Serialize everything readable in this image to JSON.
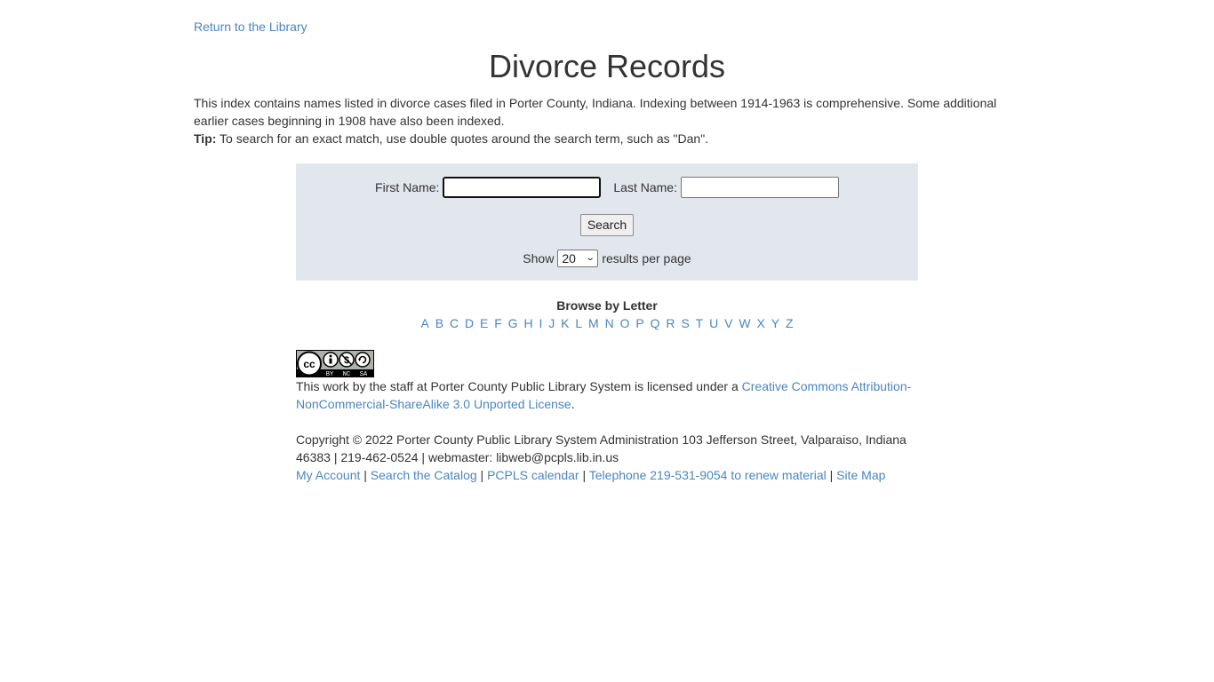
{
  "header": {
    "return_link": "Return to the Library",
    "title": "Divorce Records"
  },
  "intro": {
    "description": "This index contains names listed in divorce cases filed in Porter County, Indiana. Indexing between 1914-1963 is comprehensive. Some additional earlier cases beginning in 1908 have also been indexed.",
    "tip_label": "Tip:",
    "tip_text": " To search for an exact match, use double quotes around the search term, such as \"Dan\"."
  },
  "search": {
    "first_name_label": "First Name:",
    "first_name_value": "",
    "last_name_label": "Last Name:",
    "last_name_value": "",
    "search_button": "Search",
    "show_label": "Show",
    "per_page_value": "20",
    "per_page_suffix": "results per page"
  },
  "browse": {
    "title": "Browse by Letter",
    "letters": [
      "A",
      "B",
      "C",
      "D",
      "E",
      "F",
      "G",
      "H",
      "I",
      "J",
      "K",
      "L",
      "M",
      "N",
      "O",
      "P",
      "Q",
      "R",
      "S",
      "T",
      "U",
      "V",
      "W",
      "X",
      "Y",
      "Z"
    ]
  },
  "footer": {
    "cc_badge": {
      "main": "cc",
      "by": "BY",
      "nc": "NC",
      "sa": "SA"
    },
    "license_text": "This work by the staff at Porter County Public Library System is licensed under a ",
    "license_link": "Creative Commons Attribution-NonCommercial-ShareAlike 3.0 Unported License",
    "license_end": ".",
    "copyright": "Copyright © 2022 Porter County Public Library System Administration 103 Jefferson Street, Valparaiso, Indiana 46383 | 219-462-0524 | webmaster: libweb@pcpls.lib.in.us",
    "links": [
      {
        "label": "My Account"
      },
      {
        "label": "Search the Catalog"
      },
      {
        "label": "PCPLS calendar"
      },
      {
        "label": "Telephone 219-531-9054 to renew material"
      },
      {
        "label": "Site Map"
      }
    ],
    "separator": " | "
  },
  "colors": {
    "link": "#4a86c1",
    "text": "#333333",
    "panel": "#e2e7ed"
  }
}
